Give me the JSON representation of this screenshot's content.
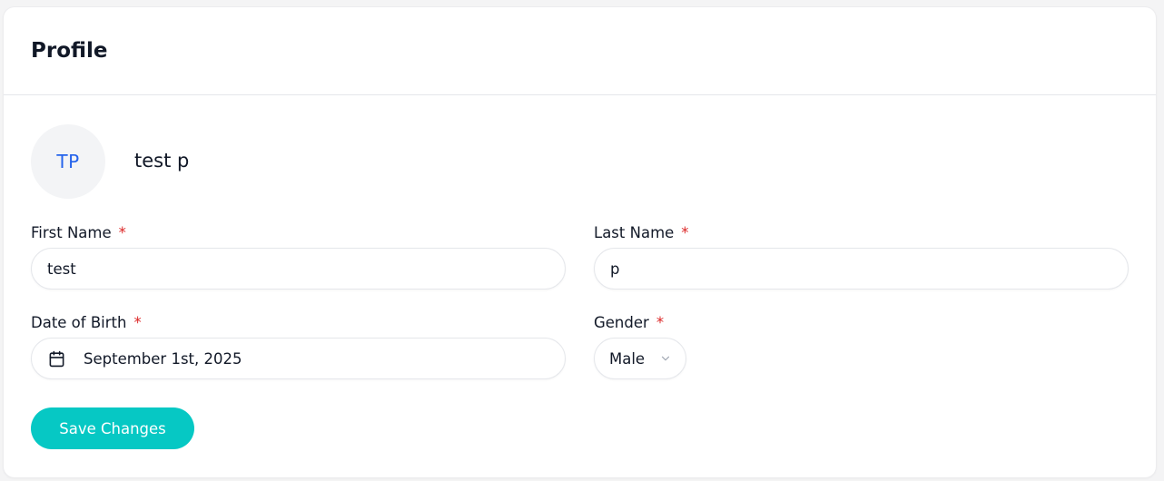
{
  "card": {
    "title": "Profile"
  },
  "profile": {
    "initials": "TP",
    "display_name": "test p"
  },
  "form": {
    "required_marker": "*",
    "first_name": {
      "label": "First Name",
      "value": "test"
    },
    "last_name": {
      "label": "Last Name",
      "value": "p"
    },
    "date_of_birth": {
      "label": "Date of Birth",
      "value": "September 1st, 2025",
      "icon": "calendar-icon"
    },
    "gender": {
      "label": "Gender",
      "value": "Male",
      "icon": "chevron-down-icon"
    }
  },
  "actions": {
    "save_label": "Save Changes"
  },
  "colors": {
    "accent": "#06c8c4",
    "initials": "#2563eb",
    "required": "#dc2626",
    "border": "#e5e7eb"
  }
}
